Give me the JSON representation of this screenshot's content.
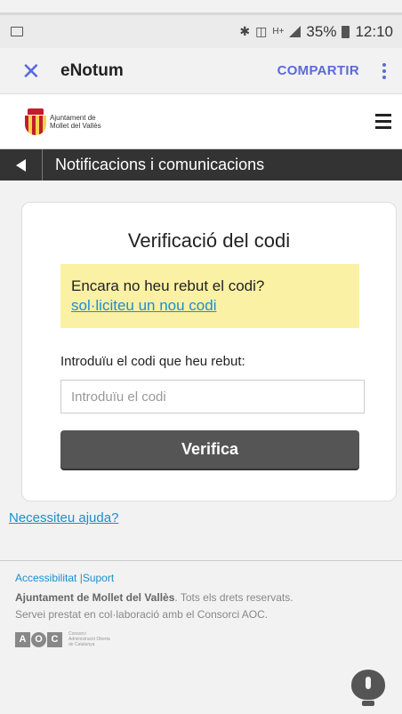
{
  "status_bar": {
    "battery": "35%",
    "time": "12:10",
    "network": "H+"
  },
  "toolbar": {
    "close_icon": "close-icon",
    "title": "eNotum",
    "share_label": "COMPARTIR",
    "more_icon": "more-vertical-icon",
    "accent_color": "#5a6bd6"
  },
  "site_header": {
    "logo_line1": "Ajuntament de",
    "logo_line2": "Mollet del Vallès",
    "menu_icon": "hamburger-icon"
  },
  "nav": {
    "back_icon": "back-arrow-icon",
    "title": "Notificacions i comunicacions"
  },
  "card": {
    "title": "Verificació del codi",
    "alert_text": "Encara no heu rebut el codi?",
    "alert_link": "sol·liciteu un nou codi",
    "code_label": "Introduïu el codi que heu rebut:",
    "code_placeholder": "Introduïu el codi",
    "code_value": "",
    "verify_label": "Verifica"
  },
  "help_link": "Necessiteu ajuda?",
  "footer": {
    "accessibility": "Accessibilitat",
    "separator": "|",
    "support": "Suport",
    "org": "Ajuntament de Mollet del Vallès",
    "rights": ". Tots els drets reservats.",
    "service": "Servei prestat en col·laboració amb el Consorci AOC.",
    "aoc_letters": [
      "A",
      "O",
      "C"
    ],
    "aoc_text1": "Consorci",
    "aoc_text2": "Administració Oberta",
    "aoc_text3": "de Catalunya"
  },
  "colors": {
    "link": "#1a8fd1",
    "alert_bg": "#fbf1a4",
    "nav_bg": "#333333",
    "button_bg": "#555555"
  }
}
